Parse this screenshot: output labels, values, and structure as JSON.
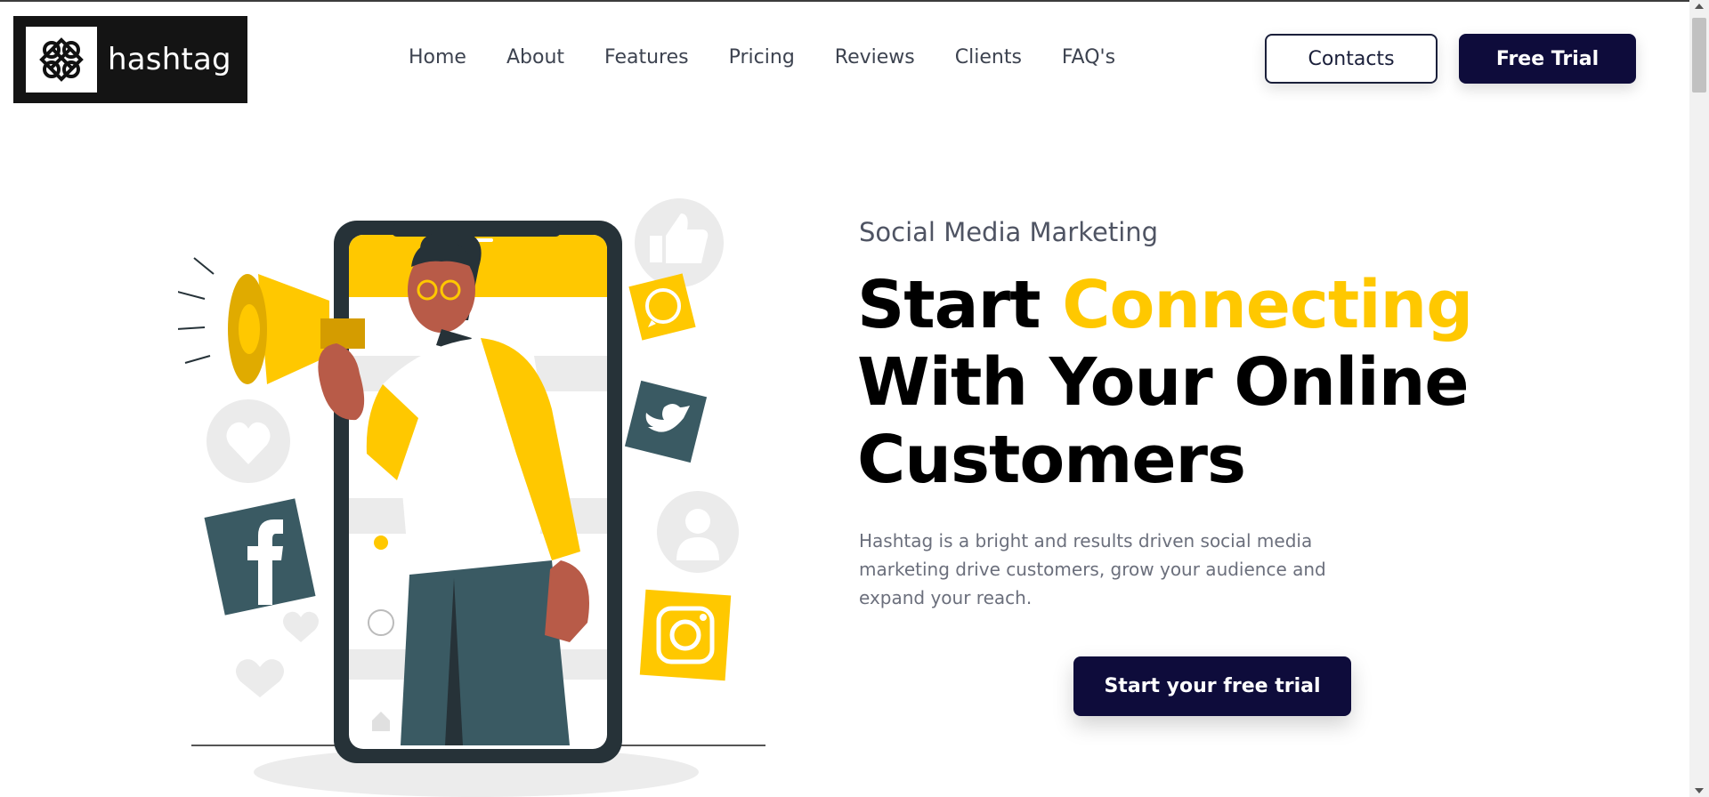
{
  "brand": {
    "name": "hashtag"
  },
  "nav": {
    "items": [
      "Home",
      "About",
      "Features",
      "Pricing",
      "Reviews",
      "Clients",
      "FAQ's"
    ]
  },
  "header_buttons": {
    "contacts": "Contacts",
    "free_trial": "Free Trial"
  },
  "hero": {
    "subtitle": "Social Media Marketing",
    "title_part1": "Start ",
    "title_accent": "Connecting",
    "title_line2": "With Your Online",
    "title_line3": "Customers",
    "description": "Hashtag is a bright and results driven social media marketing drive customers, grow your audience and expand your reach.",
    "cta": "Start your free trial"
  },
  "colors": {
    "accent": "#ffc800",
    "primary_dark": "#0e0c3b",
    "illustration_dark": "#263238",
    "illustration_teal": "#3a5a63"
  },
  "icons": [
    "megaphone-icon",
    "thumbs-up-icon",
    "whatsapp-icon",
    "twitter-icon",
    "heart-icon",
    "facebook-icon",
    "user-icon",
    "instagram-icon"
  ]
}
